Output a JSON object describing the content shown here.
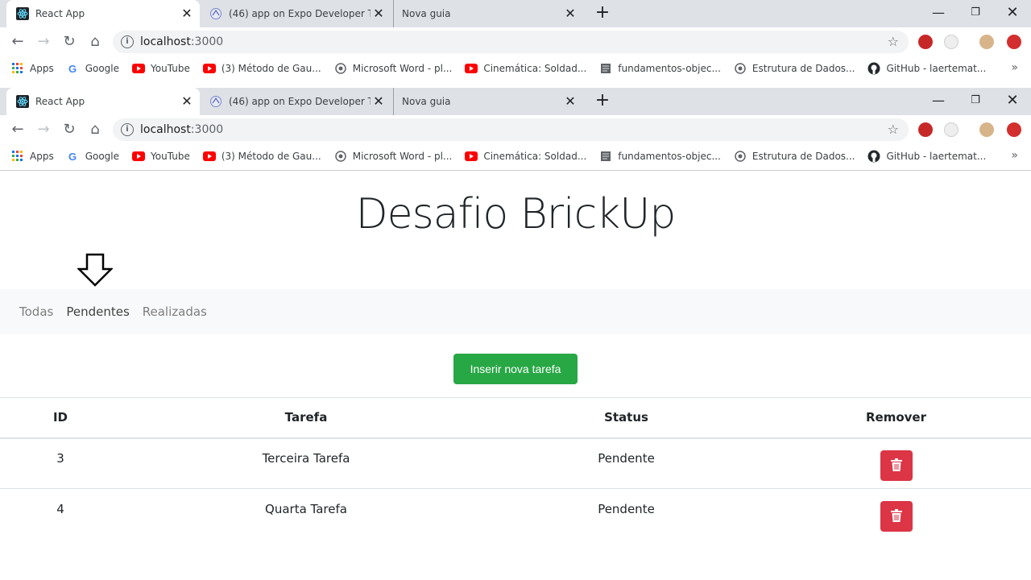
{
  "browser_windows": [
    {
      "tabs": [
        {
          "title": "React App",
          "close": "✕"
        },
        {
          "title": "(46) app on Expo Developer Tool",
          "close": "✕"
        },
        {
          "title": "Nova guia",
          "close": "✕"
        }
      ],
      "new_tab": "+",
      "window_controls": {
        "minimize": "—",
        "restore": "❐",
        "close": "✕"
      },
      "address": {
        "host": "localhost",
        "port": ":3000"
      }
    },
    {
      "tabs": [
        {
          "title": "React App",
          "close": "✕"
        },
        {
          "title": "(46) app on Expo Developer Tool",
          "close": "✕"
        },
        {
          "title": "Nova guia",
          "close": "✕"
        }
      ],
      "new_tab": "+",
      "window_controls": {
        "minimize": "—",
        "restore": "❐",
        "close": "✕"
      },
      "address": {
        "host": "localhost",
        "port": ":3000"
      }
    }
  ],
  "bookmarks": [
    {
      "label": "Apps",
      "icon": "apps-grid-icon"
    },
    {
      "label": "Google",
      "icon": "google-icon"
    },
    {
      "label": "YouTube",
      "icon": "youtube-icon"
    },
    {
      "label": "(3) Método de Gau...",
      "icon": "youtube-icon"
    },
    {
      "label": "Microsoft Word - pl...",
      "icon": "globe-icon"
    },
    {
      "label": "Cinemática: Soldad...",
      "icon": "youtube-icon"
    },
    {
      "label": "fundamentos-objec...",
      "icon": "document-icon"
    },
    {
      "label": "Estrutura de Dados...",
      "icon": "globe-icon"
    },
    {
      "label": "GitHub - laertemat...",
      "icon": "github-icon"
    }
  ],
  "bookmarks_more": "»",
  "page": {
    "title": "Desafio BrickUp",
    "nav": [
      "Todas",
      "Pendentes",
      "Realizadas"
    ],
    "insert_button": "Inserir nova tarefa",
    "table": {
      "headers": [
        "ID",
        "Tarefa",
        "Status",
        "Remover"
      ],
      "rows": [
        {
          "id": "3",
          "task": "Terceira Tarefa",
          "status": "Pendente"
        },
        {
          "id": "4",
          "task": "Quarta Tarefa",
          "status": "Pendente"
        }
      ]
    }
  },
  "colors": {
    "success": "#28a745",
    "danger": "#dc3545",
    "navbar_bg": "#f8f9fa",
    "tabstrip_bg": "#dee1e6"
  }
}
